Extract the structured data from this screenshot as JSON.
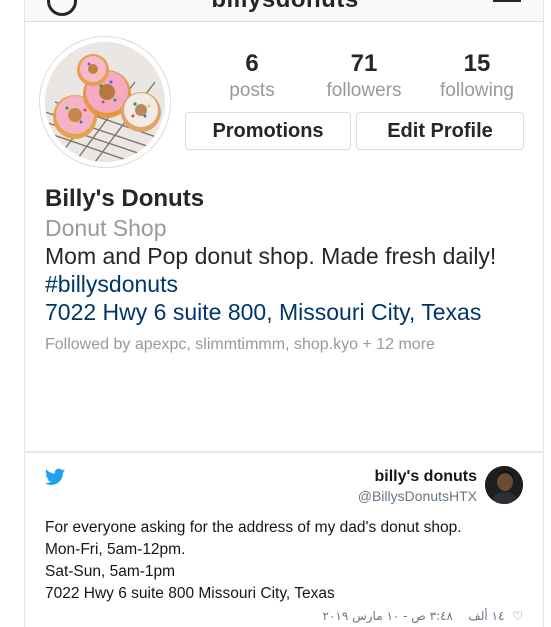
{
  "instagram": {
    "username": "billysdonuts",
    "stats": {
      "posts": {
        "count": "6",
        "label": "posts"
      },
      "followers": {
        "count": "71",
        "label": "followers"
      },
      "following": {
        "count": "15",
        "label": "following"
      }
    },
    "buttons": {
      "promotions": "Promotions",
      "edit_profile": "Edit Profile"
    },
    "bio": {
      "name": "Billy's Donuts",
      "category": "Donut Shop",
      "description": "Mom and Pop donut shop. Made fresh daily!",
      "hashtag": "#billysdonuts",
      "address": "7022 Hwy 6 suite 800, Missouri City, Texas",
      "followed_by": "Followed by apexpc, slimmtimmm, shop.kyo + 12 more"
    },
    "colors": {
      "link": "#003569",
      "muted": "#999999",
      "text": "#262626"
    }
  },
  "tweet": {
    "display_name": "billy's donuts",
    "handle": "@BillysDonutsHTX",
    "lines": [
      "For everyone asking for the address of my dad's donut shop.",
      "Mon-Fri, 5am-12pm.",
      "Sat-Sun, 5am-1pm",
      "7022 Hwy 6 suite 800 Missouri City, Texas"
    ],
    "likes": "١٤ ألف",
    "timestamp": "٣:٤٨ ص - ١٠ مارس ٢٠١٩",
    "icons": {
      "logo": "twitter-bird-icon",
      "like": "heart-icon"
    },
    "colors": {
      "brand": "#1da1f2",
      "muted": "#657786"
    }
  }
}
